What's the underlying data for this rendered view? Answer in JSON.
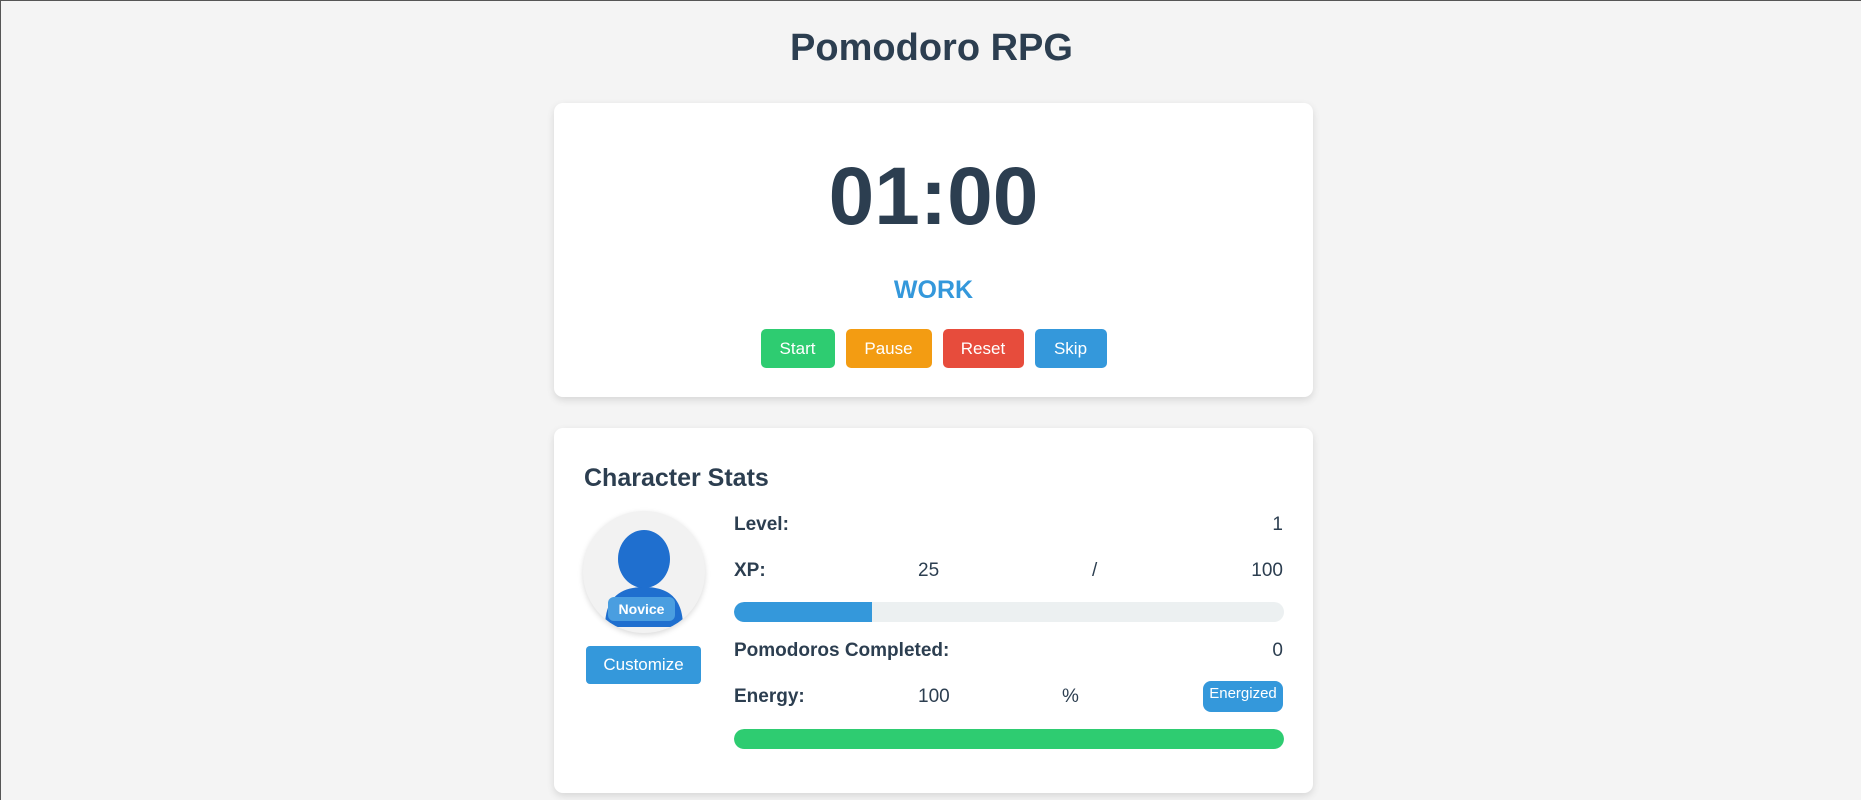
{
  "app": {
    "title": "Pomodoro RPG"
  },
  "timer": {
    "display": "01:00",
    "mode": "WORK",
    "buttons": {
      "start": "Start",
      "pause": "Pause",
      "reset": "Reset",
      "skip": "Skip"
    }
  },
  "stats": {
    "title": "Character Stats",
    "avatar": {
      "icon": "person-silhouette-icon",
      "rank": "Novice"
    },
    "customize_label": "Customize",
    "level": {
      "label": "Level:",
      "value": "1"
    },
    "xp": {
      "label": "XP:",
      "current": "25",
      "separator": "/",
      "max": "100",
      "fraction": 0.25
    },
    "pomodoros": {
      "label": "Pomodoros Completed:",
      "value": "0"
    },
    "energy": {
      "label": "Energy:",
      "value": "100",
      "unit": "%",
      "status": "Energized",
      "fraction": 1.0
    }
  },
  "colors": {
    "primary": "#3498db",
    "start": "#2ecc71",
    "pause": "#f39c12",
    "reset": "#e74c3c",
    "text": "#2c3e50",
    "xp_bar": "#3498db",
    "energy_bar": "#2ecc71",
    "track": "#ecf0f1"
  }
}
